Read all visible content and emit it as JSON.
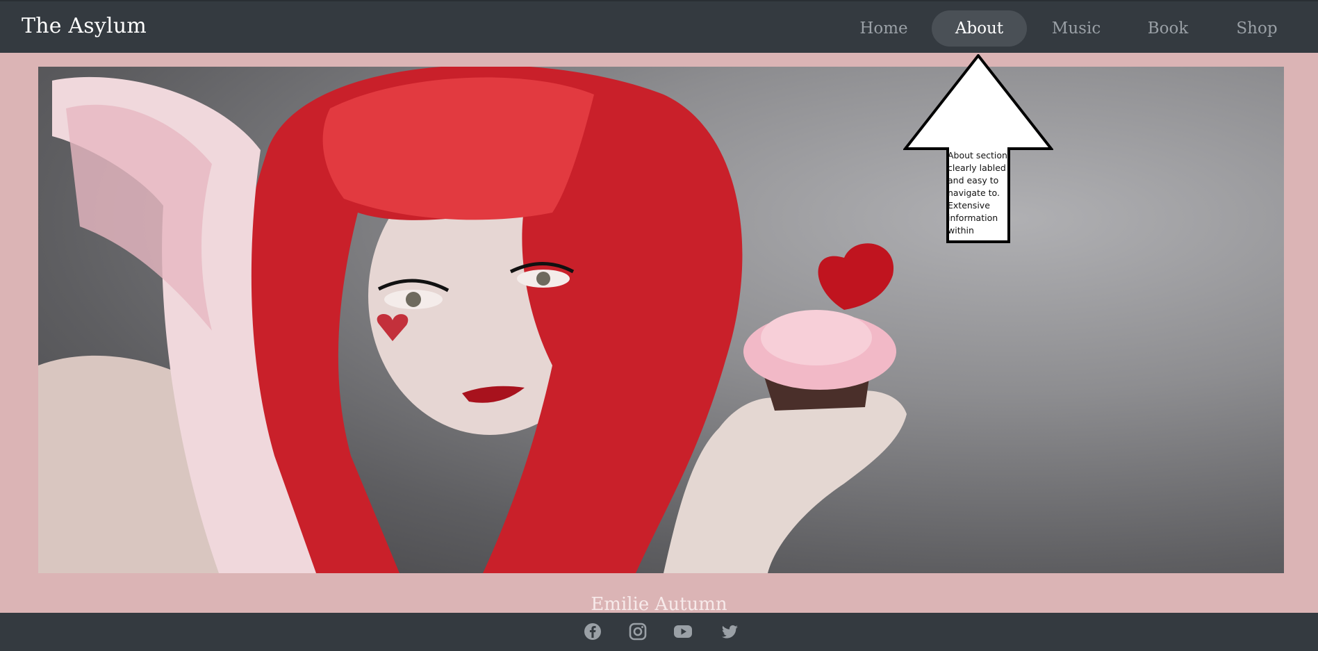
{
  "brand": "The Asylum",
  "nav": {
    "items": [
      {
        "label": "Home",
        "active": false
      },
      {
        "label": "About",
        "active": true
      },
      {
        "label": "Music",
        "active": false
      },
      {
        "label": "Book",
        "active": false
      },
      {
        "label": "Shop",
        "active": false
      }
    ]
  },
  "hero": {
    "image": "red-haired-woman-with-heart-cupcake"
  },
  "annotation": {
    "text": "About section clearly labled and easy to navigate to. Extensive information within"
  },
  "footer": {
    "title": "Emilie Autumn",
    "social_icons": [
      "facebook-icon",
      "instagram-icon",
      "youtube-icon",
      "twitter-icon"
    ]
  },
  "colors": {
    "navbar": "#343a40",
    "background": "#dbb4b5",
    "active_pill": "#4a5056",
    "nav_text": "#9aa0a6"
  }
}
